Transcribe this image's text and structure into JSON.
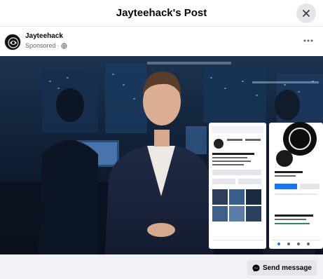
{
  "modal": {
    "title": "Jayteehack's Post"
  },
  "post": {
    "author": "Jayteehack",
    "sponsored_label": "Sponsored",
    "separator": "·",
    "privacy_icon": "globe-icon"
  },
  "video": {
    "description_icon": "ad-video-thumbnail"
  },
  "footer": {
    "send_message_label": "Send message",
    "send_icon": "messenger-icon"
  },
  "colors": {
    "header_border": "#e4e6eb",
    "footer_bg": "#f0f2f5",
    "button_bg": "#e4e6eb",
    "text_primary": "#050505",
    "text_secondary": "#65676b"
  }
}
